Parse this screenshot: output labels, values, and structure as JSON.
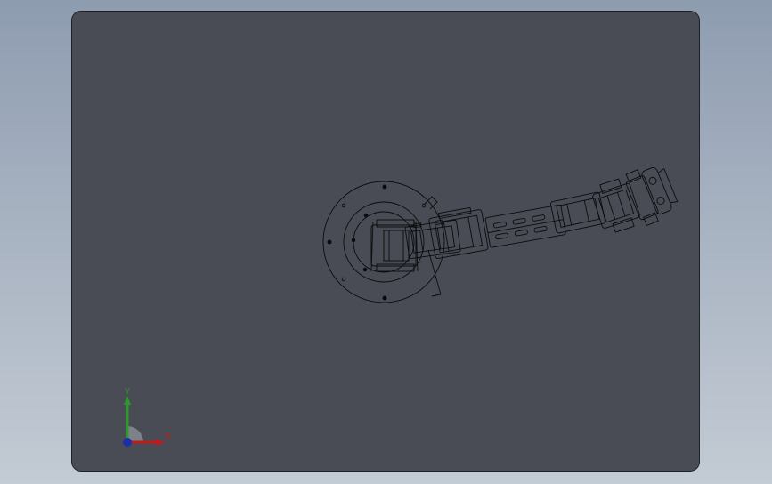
{
  "triad": {
    "x_label": "X",
    "y_label": "Y"
  },
  "colors": {
    "background": "#a7b2c1",
    "viewport": "#494c55",
    "edges": "#0b0c0e",
    "x_axis": "#c41a1a",
    "y_axis": "#2a9a2a",
    "z_axis": "#1b2fa8"
  }
}
